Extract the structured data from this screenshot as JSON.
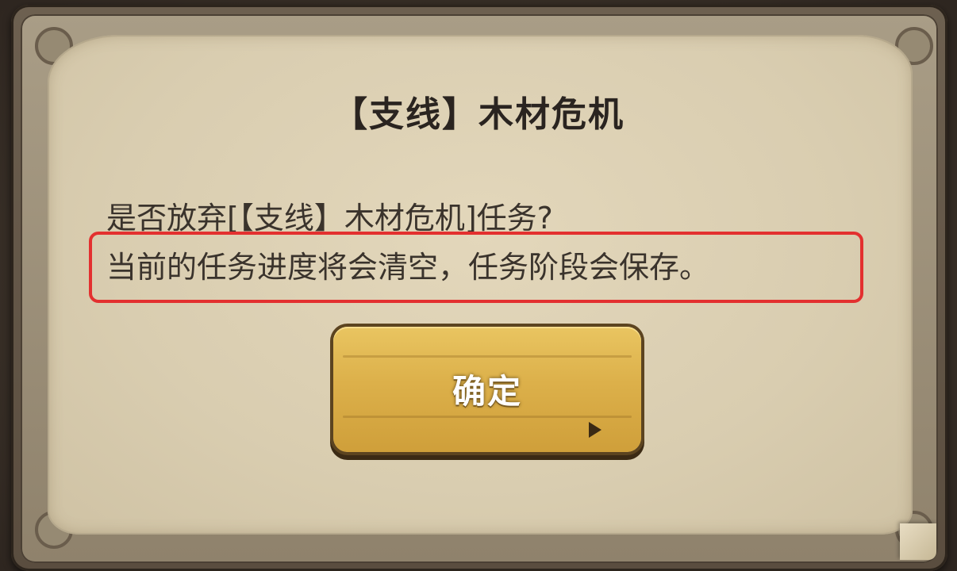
{
  "dialog": {
    "title": "【支线】木材危机",
    "message_line1": "是否放弃[【支线】木材危机]任务?",
    "message_line2": "当前的任务进度将会清空，任务阶段会保存。",
    "confirm_label": "确定"
  },
  "colors": {
    "parchment": "#d9cdb0",
    "frame": "#5a4d3f",
    "button": "#dcb04a",
    "highlight": "#e3302f",
    "text": "#2a2420"
  }
}
